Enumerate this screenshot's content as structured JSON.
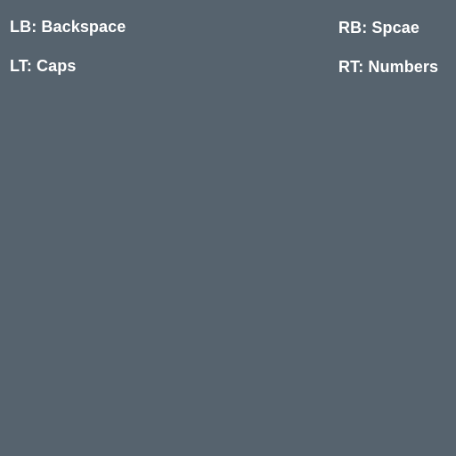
{
  "theme": {
    "background": "#56636e",
    "text": "#ffffff"
  },
  "hints": {
    "lb": "LB: Backspace",
    "lt": "LT: Caps",
    "rb": "RB: Spcae",
    "rt": "RT: Numbers"
  }
}
